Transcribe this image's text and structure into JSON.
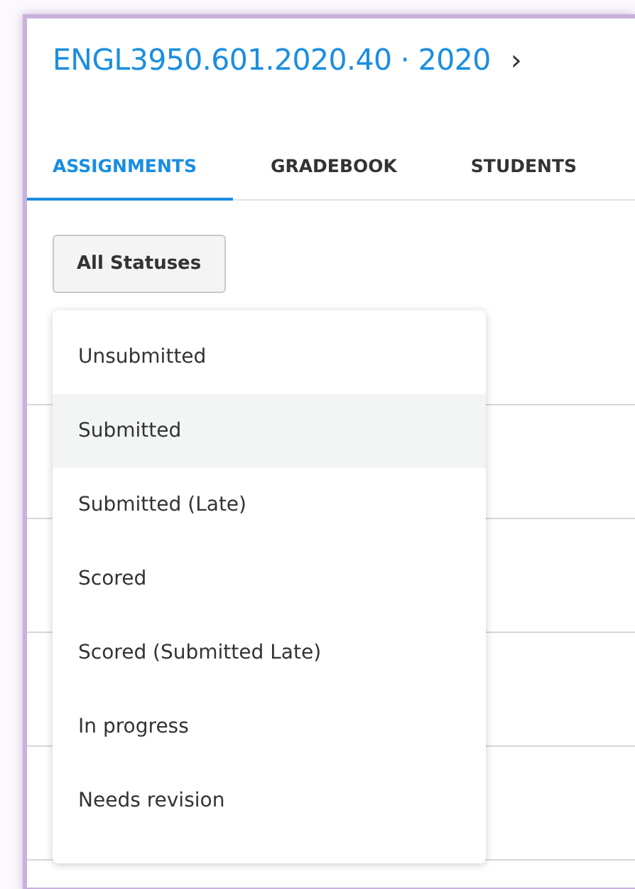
{
  "breadcrumb": {
    "course": "ENGL3950.601.2020.40 · 2020",
    "separator": "›"
  },
  "tabs": [
    {
      "label": "ASSIGNMENTS",
      "selected": true
    },
    {
      "label": "GRADEBOOK",
      "selected": false
    },
    {
      "label": "STUDENTS",
      "selected": false
    }
  ],
  "status_filter": {
    "label": "All Statuses",
    "options": [
      {
        "label": "Unsubmitted",
        "selected": false
      },
      {
        "label": "Submitted",
        "selected": true
      },
      {
        "label": "Submitted (Late)",
        "selected": false
      },
      {
        "label": "Scored",
        "selected": false
      },
      {
        "label": "Scored (Submitted Late)",
        "selected": false
      },
      {
        "label": "In progress",
        "selected": false
      },
      {
        "label": "Needs revision",
        "selected": false
      }
    ]
  }
}
